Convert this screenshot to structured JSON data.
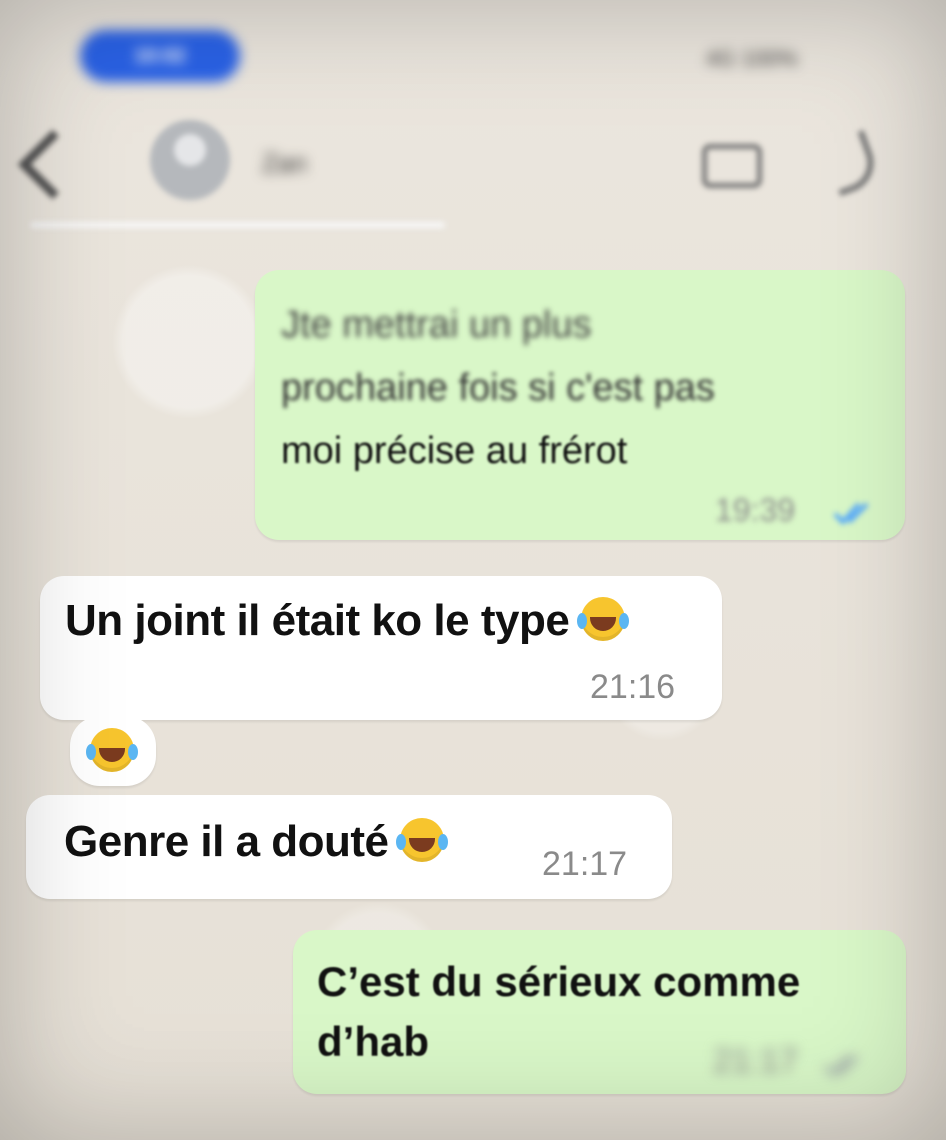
{
  "status_bar": {
    "time_pill": "10:02",
    "right_indicators": "4G 100%"
  },
  "header": {
    "contact_name": "Zan"
  },
  "messages": [
    {
      "direction": "out",
      "lines": [
        "Jte mettrai un plus",
        "prochaine fois si c'est pas",
        "moi précise au frérot"
      ],
      "time": "19:39",
      "read": true
    },
    {
      "direction": "in",
      "text": "Un joint il était ko le type",
      "time": "21:16"
    },
    {
      "direction": "in",
      "reaction": "😂"
    },
    {
      "direction": "in",
      "text": "Genre il a douté",
      "time": "21:17"
    },
    {
      "direction": "out",
      "lines": [
        "C’est du sérieux comme",
        "d’hab"
      ],
      "time": "21:17",
      "read": true
    }
  ],
  "colors": {
    "outgoing_bubble": "#d9f7c8",
    "incoming_bubble": "#ffffff",
    "tick_blue": "#4aa3ff",
    "status_pill": "#2a62e6"
  }
}
